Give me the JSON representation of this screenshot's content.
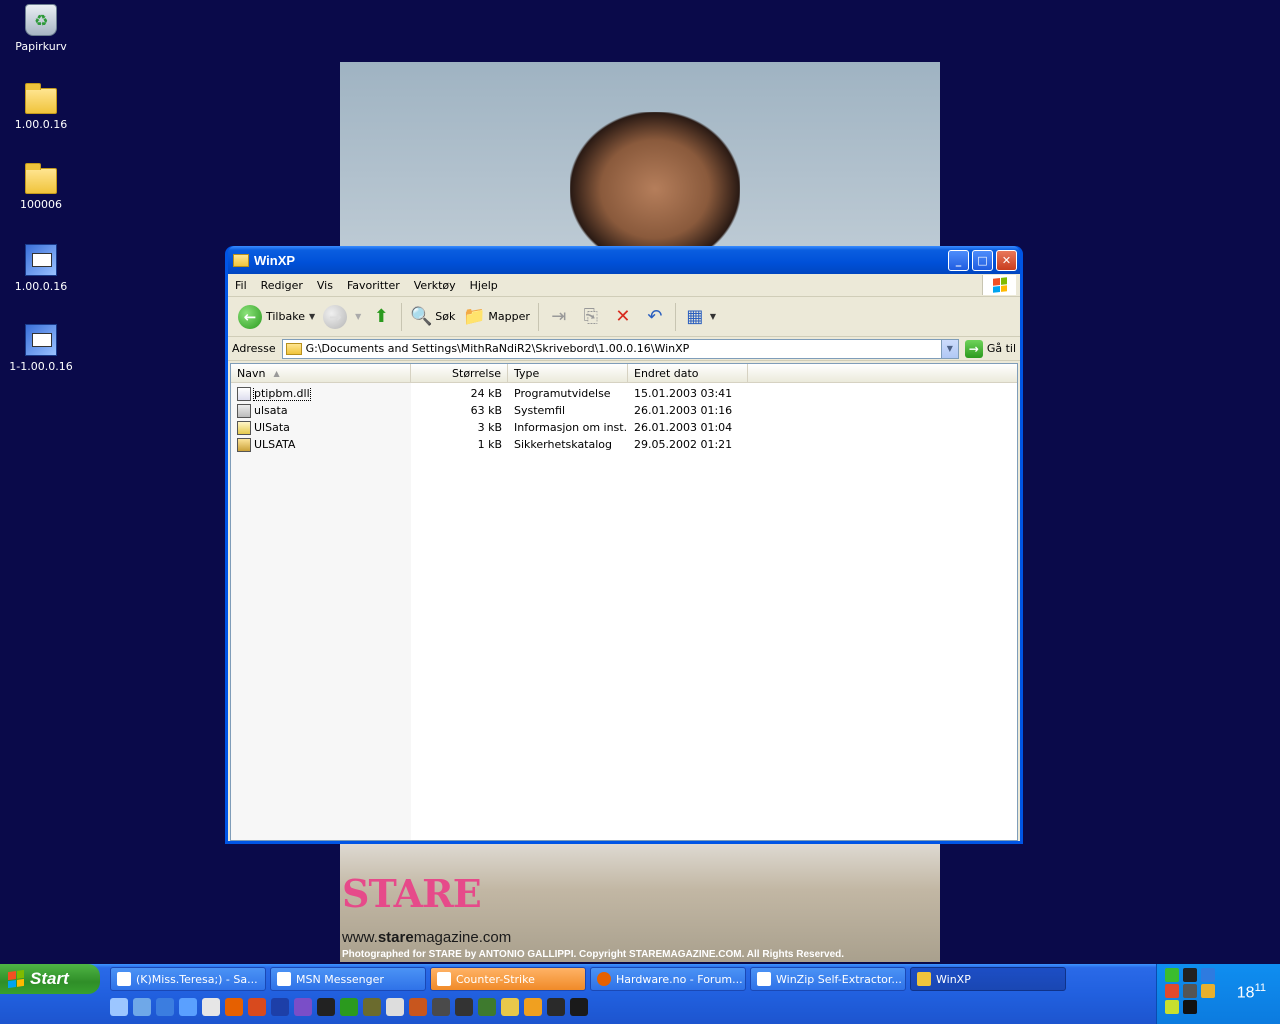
{
  "desktop": {
    "icons": [
      {
        "label": "Papirkurv",
        "icon": "recycle-bin-icon"
      },
      {
        "label": "1.00.0.16",
        "icon": "folder-icon"
      },
      {
        "label": "100006",
        "icon": "folder-icon"
      },
      {
        "label": "1.00.0.16",
        "icon": "setup-icon"
      },
      {
        "label": "1-1.00.0.16",
        "icon": "setup-icon"
      }
    ],
    "wallpaper": {
      "brand": "STARE",
      "url_prefix": "www.",
      "url_bold": "stare",
      "url_suffix": "magazine.com",
      "credit": "Photographed for STARE by ANTONIO GALLIPPI.  Copyright STAREMAGAZINE.COM.  All Rights Reserved."
    }
  },
  "window": {
    "title": "WinXP",
    "menu": [
      "Fil",
      "Rediger",
      "Vis",
      "Favoritter",
      "Verktøy",
      "Hjelp"
    ],
    "toolbar": {
      "back": "Tilbake",
      "search": "Søk",
      "folders": "Mapper"
    },
    "address": {
      "label": "Adresse",
      "value": "G:\\Documents and Settings\\MithRaNdiR2\\Skrivebord\\1.00.0.16\\WinXP",
      "go": "Gå til"
    },
    "columns": [
      "Navn",
      "Størrelse",
      "Type",
      "Endret dato"
    ],
    "files": [
      {
        "name": "ptipbm.dll",
        "size": "24 kB",
        "type": "Programutvidelse",
        "date": "15.01.2003 03:41",
        "icon": "dll"
      },
      {
        "name": "ulsata",
        "size": "63 kB",
        "type": "Systemfil",
        "date": "26.01.2003 01:16",
        "icon": "sys"
      },
      {
        "name": "UlSata",
        "size": "3 kB",
        "type": "Informasjon om inst...",
        "date": "26.01.2003 01:04",
        "icon": "inf"
      },
      {
        "name": "ULSATA",
        "size": "1 kB",
        "type": "Sikkerhetskatalog",
        "date": "29.05.2002 01:21",
        "icon": "cat"
      }
    ]
  },
  "taskbar": {
    "start": "Start",
    "tasks": [
      {
        "label": "(K)Miss.Teresa;) - Sa...",
        "state": "normal"
      },
      {
        "label": "MSN Messenger",
        "state": "normal"
      },
      {
        "label": "Counter-Strike",
        "state": "flash"
      },
      {
        "label": "Hardware.no - Forum...",
        "state": "normal"
      },
      {
        "label": "WinZip Self-Extractor...",
        "state": "normal"
      },
      {
        "label": "WinXP",
        "state": "active"
      }
    ],
    "clock_hour": "18",
    "clock_min": "11"
  },
  "colors": {
    "desktop_bg": "#0a0a4a",
    "title_blue": "#0050d8",
    "taskbar_blue": "#2160df",
    "start_green": "#2f8e28"
  }
}
